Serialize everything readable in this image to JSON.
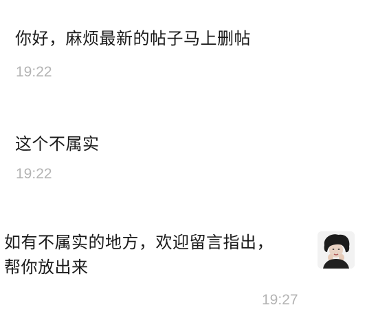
{
  "messages": [
    {
      "text": "你好，麻烦最新的帖子马上删帖",
      "time": "19:22",
      "side": "left"
    },
    {
      "text": "这个不属实",
      "time": "19:22",
      "side": "left"
    },
    {
      "line1": "如有不属实的地方，欢迎留言指出，",
      "line2": "帮你放出来",
      "time": "19:27",
      "side": "right"
    }
  ],
  "avatar": {
    "icon": "user-avatar-photo-icon"
  }
}
